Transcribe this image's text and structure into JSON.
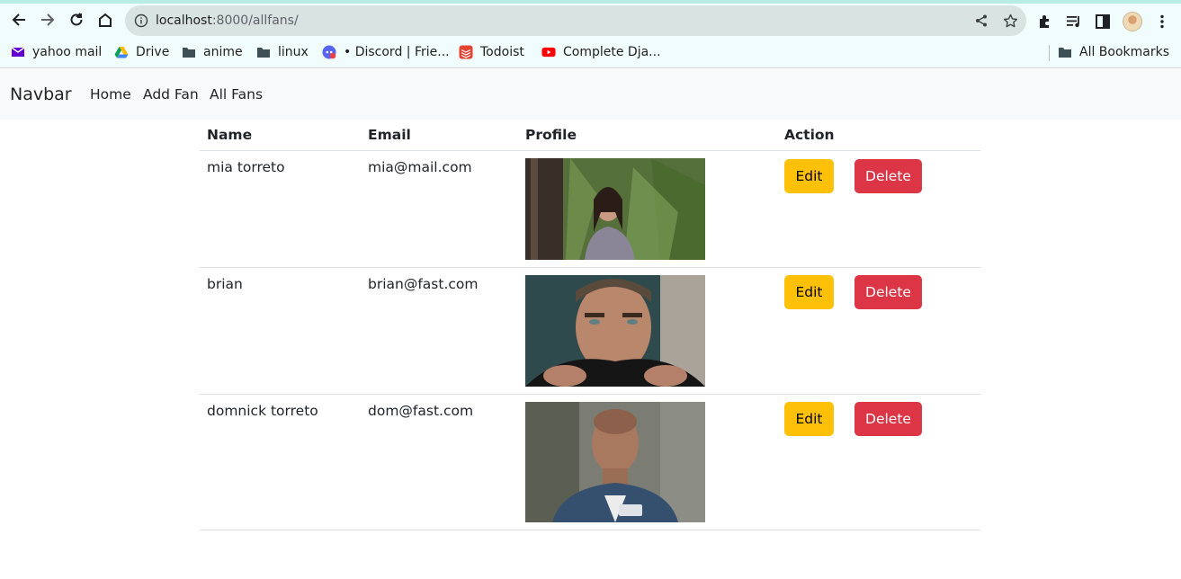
{
  "browser": {
    "url_host": "localhost",
    "url_path": ":8000/allfans/",
    "bookmarks": [
      {
        "label": "yahoo mail",
        "icon": "mail-icon"
      },
      {
        "label": "Drive",
        "icon": "drive-icon"
      },
      {
        "label": "anime",
        "icon": "folder-icon"
      },
      {
        "label": "linux",
        "icon": "folder-icon"
      },
      {
        "label": "• Discord | Frie...",
        "icon": "discord-icon"
      },
      {
        "label": "Todoist",
        "icon": "todoist-icon"
      },
      {
        "label": "Complete Dja...",
        "icon": "youtube-icon"
      }
    ],
    "all_bookmarks": "All Bookmarks"
  },
  "navbar": {
    "brand": "Navbar",
    "links": [
      "Home",
      "Add Fan",
      "All Fans"
    ]
  },
  "table": {
    "headers": [
      "Name",
      "Email",
      "Profile",
      "Action"
    ],
    "rows": [
      {
        "name": "mia torreto",
        "email": "mia@mail.com",
        "edit": "Edit",
        "delete": "Delete"
      },
      {
        "name": "brian",
        "email": "brian@fast.com",
        "edit": "Edit",
        "delete": "Delete"
      },
      {
        "name": "domnick torreto",
        "email": "dom@fast.com",
        "edit": "Edit",
        "delete": "Delete"
      }
    ]
  },
  "colors": {
    "edit": "#ffc107",
    "delete": "#dc3545",
    "navbar_bg": "#f8f9fa"
  }
}
